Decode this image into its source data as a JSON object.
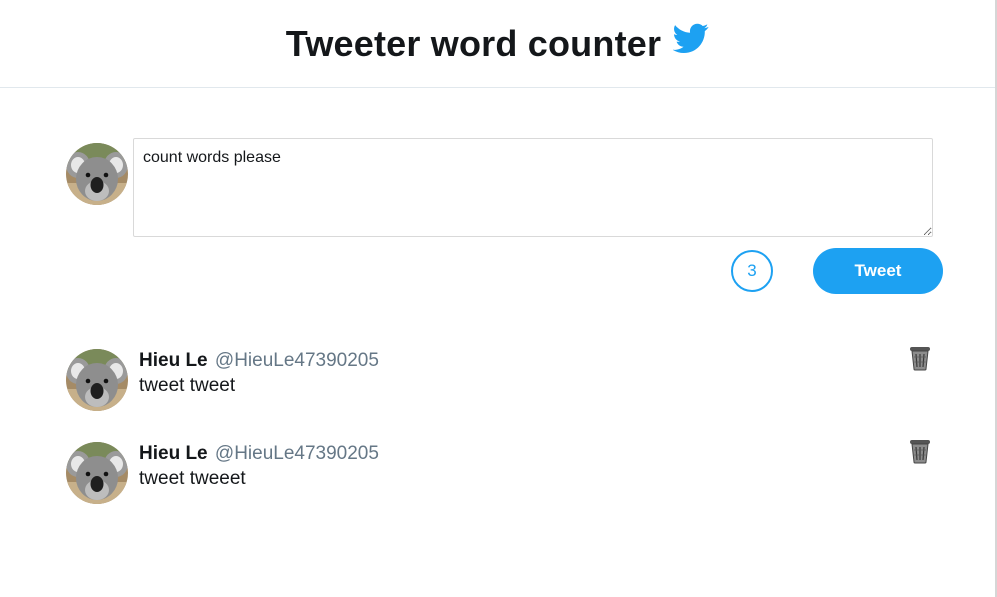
{
  "header": {
    "title": "Tweeter word counter",
    "logo_icon": "twitter-bird-icon",
    "brand_color": "#1da1f2"
  },
  "composer": {
    "avatar_icon": "koala-avatar",
    "text": "count words please",
    "word_count": "3",
    "tweet_button_label": "Tweet"
  },
  "tweets": [
    {
      "name": "Hieu Le",
      "handle": "@HieuLe47390205",
      "text": "tweet tweet",
      "delete_icon": "trash-can-icon"
    },
    {
      "name": "Hieu Le",
      "handle": "@HieuLe47390205",
      "text": "tweet tweeet",
      "delete_icon": "trash-can-icon"
    }
  ]
}
